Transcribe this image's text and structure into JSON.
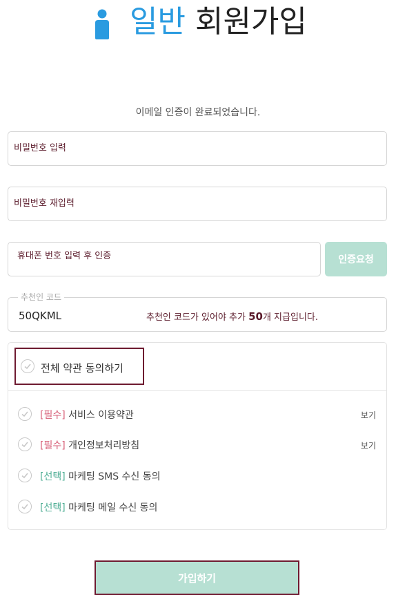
{
  "header": {
    "title_accent": "일반",
    "title_rest": "회원가입",
    "icon": "person-icon"
  },
  "notice": "이메일 인증이 완료되었습니다.",
  "form": {
    "password_placeholder": "비밀번호 입력",
    "password_confirm_placeholder": "비밀번호 재입력",
    "phone_placeholder": "휴대폰 번호 입력 후 인증",
    "verify_button": "인증요청",
    "referral_legend": "추천인 코드",
    "referral_value": "50QKML",
    "referral_hint_prefix": "추천인 코드가 있어야 추가 ",
    "referral_hint_amount": "50",
    "referral_hint_suffix": "개 지급입니다."
  },
  "terms": {
    "all_label": "전체 약관 동의하기",
    "items": [
      {
        "tag": "[필수]",
        "label": "서비스 이용약관",
        "view": "보기"
      },
      {
        "tag": "[필수]",
        "label": "개인정보처리방침",
        "view": "보기"
      },
      {
        "tag": "[선택]",
        "label": "마케팅 SMS 수신 동의"
      },
      {
        "tag": "[선택]",
        "label": "마케팅 메일 수신 동의"
      }
    ]
  },
  "submit_label": "가입하기",
  "colors": {
    "accent": "#2a9be0",
    "button": "#b7e0d3",
    "highlight_border": "#6e1a30",
    "required_tag": "#d65b74",
    "optional_tag": "#4fae94"
  }
}
